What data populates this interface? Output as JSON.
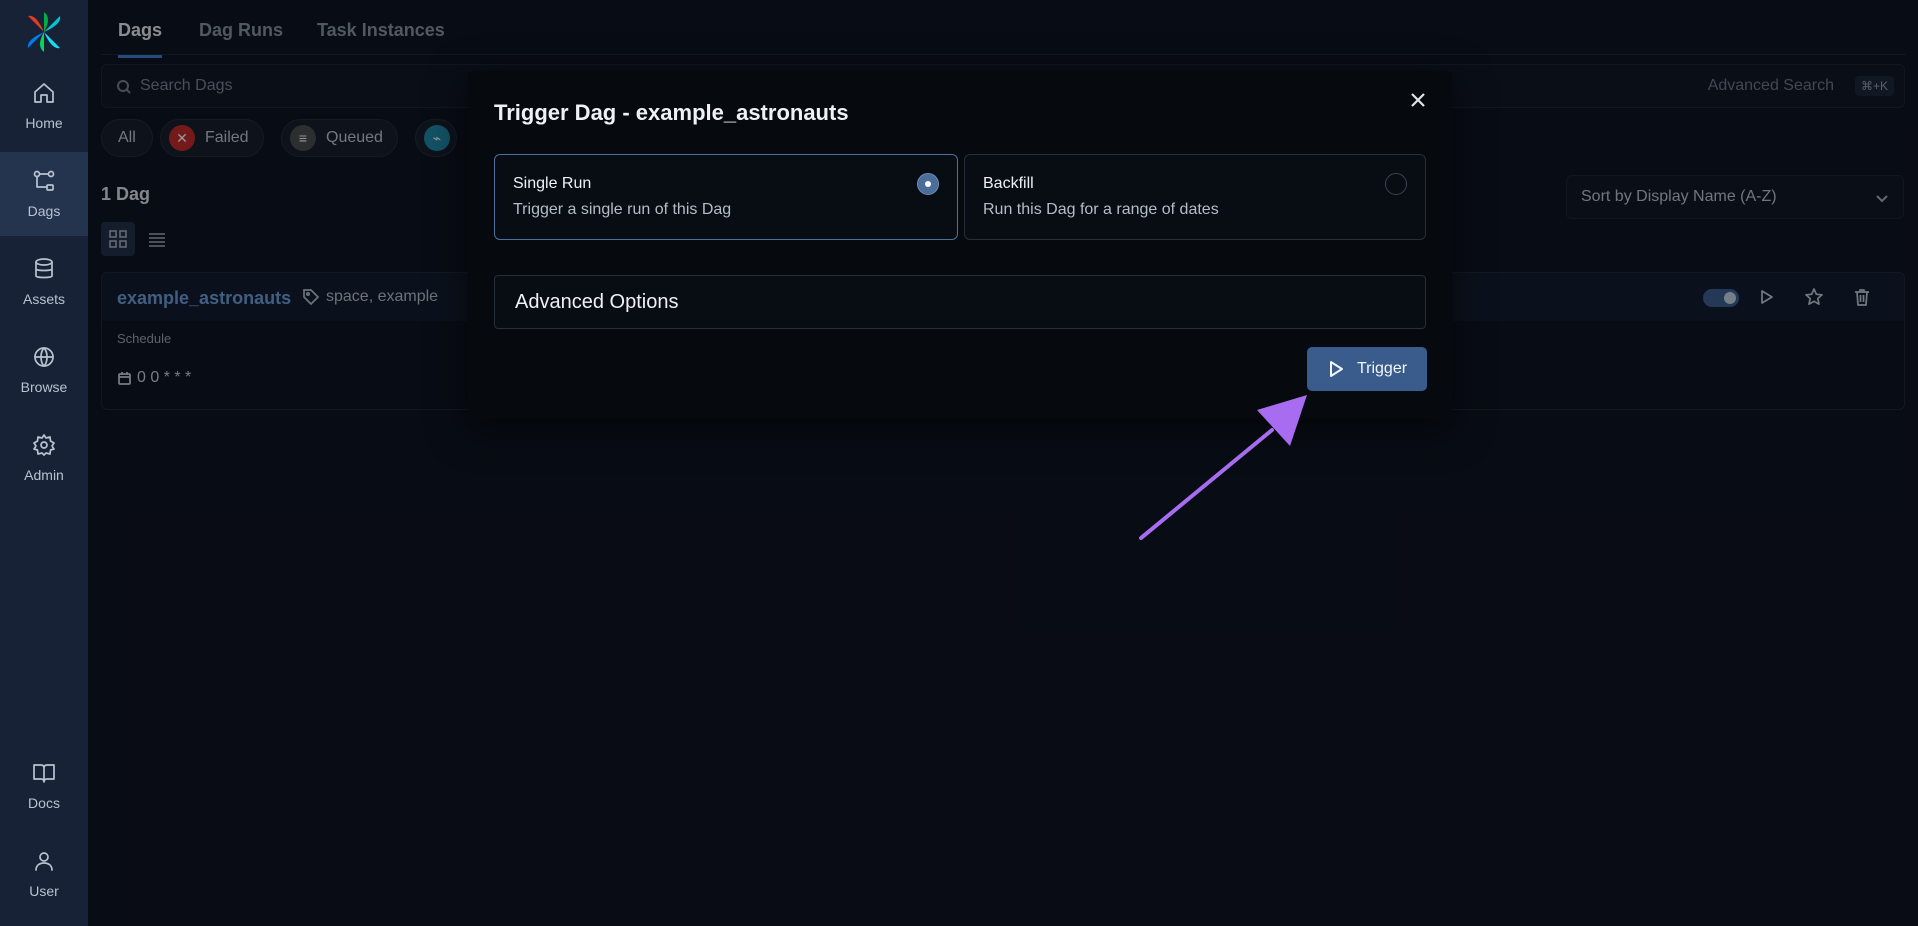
{
  "sidebar": {
    "items": [
      {
        "label": "Home",
        "icon": "home-icon"
      },
      {
        "label": "Dags",
        "icon": "dags-icon",
        "active": true
      },
      {
        "label": "Assets",
        "icon": "database-icon"
      },
      {
        "label": "Browse",
        "icon": "globe-icon"
      },
      {
        "label": "Admin",
        "icon": "gear-icon"
      },
      {
        "label": "Docs",
        "icon": "book-icon"
      },
      {
        "label": "User",
        "icon": "user-icon"
      }
    ]
  },
  "tabs": [
    {
      "label": "Dags",
      "active": true
    },
    {
      "label": "Dag Runs"
    },
    {
      "label": "Task Instances"
    }
  ],
  "search": {
    "placeholder": "Search Dags",
    "advanced_label": "Advanced Search",
    "shortcut": "⌘+K"
  },
  "filters": [
    {
      "label": "All"
    },
    {
      "label": "Failed",
      "color": "#c62828"
    },
    {
      "label": "Queued",
      "color": "#5a5a5a"
    },
    {
      "label": "",
      "color": "#1e88a8"
    }
  ],
  "dag_count": "1 Dag",
  "sort": {
    "label": "Sort by Display Name (A-Z)"
  },
  "dag": {
    "id": "example_astronauts",
    "tags": "space, example",
    "schedule_label": "Schedule",
    "schedule": "0 0 * * *"
  },
  "modal": {
    "title": "Trigger Dag - example_astronauts",
    "options": [
      {
        "title": "Single Run",
        "description": "Trigger a single run of this Dag",
        "selected": true
      },
      {
        "title": "Backfill",
        "description": "Run this Dag for a range of dates",
        "selected": false
      }
    ],
    "advanced_options": "Advanced Options",
    "trigger_label": "Trigger"
  },
  "colors": {
    "accent": "#3d7bd0",
    "trigger_button": "#3a5c8c",
    "annotation_arrow": "#a86cf0"
  }
}
